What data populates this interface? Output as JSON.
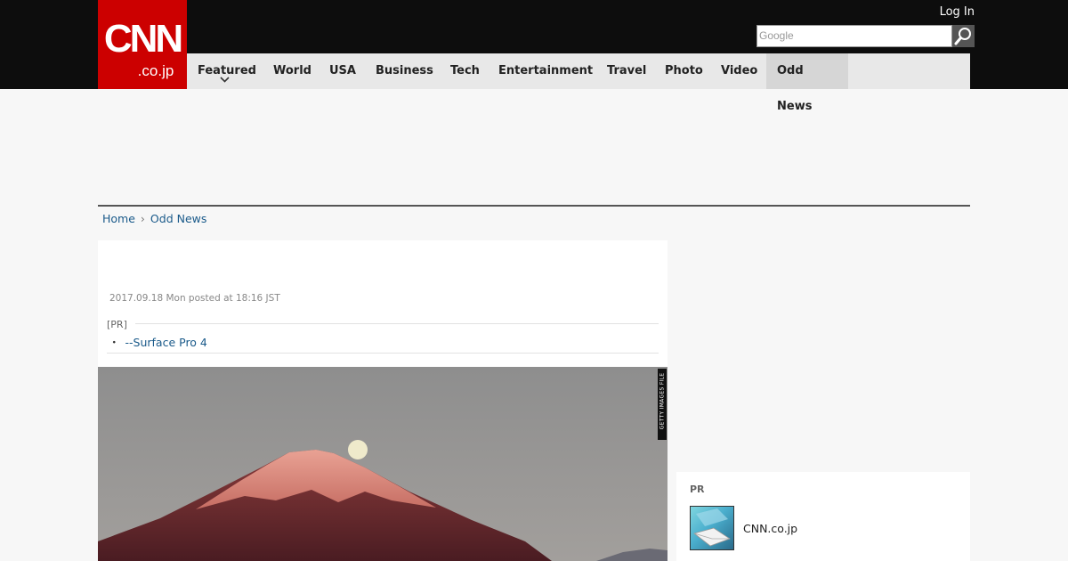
{
  "header": {
    "logo_top": "CNN",
    "logo_bottom": ".co.jp",
    "login_label": "Log In",
    "search_placeholder": "Google"
  },
  "nav": {
    "items": [
      "Featured",
      "World",
      "USA",
      "Business",
      "Tech",
      "Entertainment",
      "Travel",
      "Photo",
      "Video",
      "Odd News"
    ],
    "active": "Odd News"
  },
  "breadcrumb": {
    "home": "Home",
    "current": "Odd News"
  },
  "article": {
    "posted": "2017.09.18 Mon posted at 18:16 JST",
    "pr_label": "[PR]",
    "pr_link": "--Surface Pro 4",
    "photo_credit": "GETTY IMAGES FILE"
  },
  "sidebar": {
    "pr_label": "PR",
    "item_name": "CNN.co.jp"
  },
  "colors": {
    "brand_red": "#cc0000",
    "topbar": "#0d0d0d",
    "nav_bg": "#e8e8e8",
    "link": "#1a5a8a"
  }
}
